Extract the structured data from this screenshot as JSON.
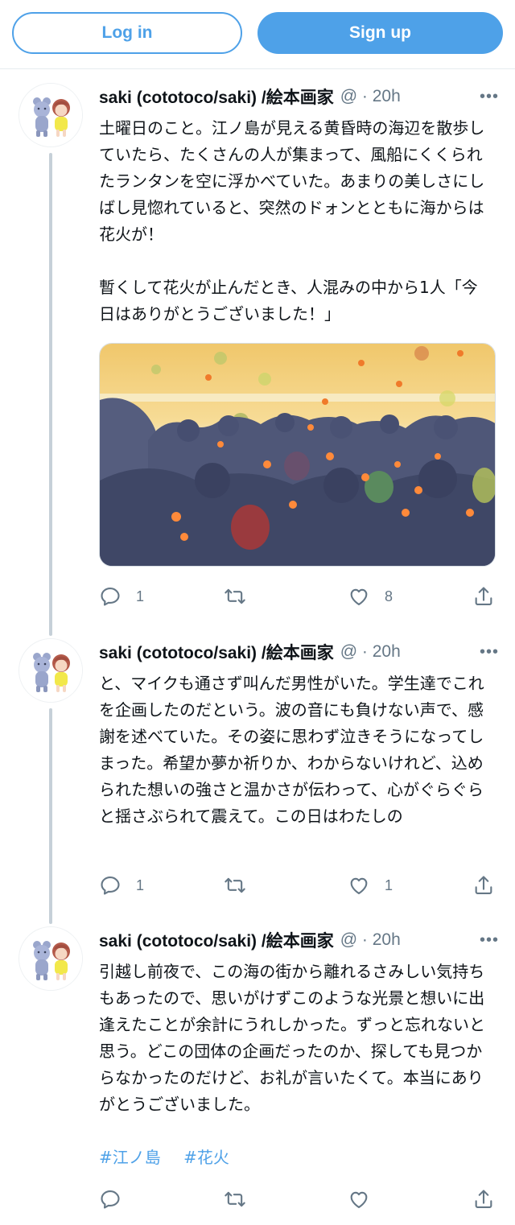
{
  "topbar": {
    "login_label": "Log in",
    "signup_label": "Sign up"
  },
  "colors": {
    "accent": "#4ea1e8",
    "secondary_text": "#657786",
    "thread_line": "#c6d0d8"
  },
  "tweets": [
    {
      "name": "saki (cototoco/saki) /絵本画家",
      "meta": "@ · 20h",
      "text": "土曜日のこと。江ノ島が見える黄昏時の海辺を散歩していたら、たくさんの人が集まって、風船にくくられたランタンを空に浮かべていた。あまりの美しさにしばし見惚れていると、突然のドォンとともに海からは花火が！\n\n暫くして花火が止んだとき、人混みの中から1人「今日はありがとうございました！」",
      "reply_count": "1",
      "retweet_count": "",
      "like_count": "8"
    },
    {
      "name": "saki (cototoco/saki) /絵本画家",
      "meta": "@ · 20h",
      "text": "と、マイクも通さず叫んだ男性がいた。学生達でこれを企画したのだという。波の音にも負けない声で、感謝を述べていた。その姿に思わず泣きそうになってしまった。希望か夢か祈りか、わからないけれど、込められた想いの強さと温かさが伝わって、心がぐらぐらと揺さぶられて震えて。この日はわたしの",
      "reply_count": "1",
      "retweet_count": "",
      "like_count": "1"
    },
    {
      "name": "saki (cototoco/saki) /絵本画家",
      "meta": "@ · 20h",
      "text": "引越し前夜で、この海の街から離れるさみしい気持ちもあったので、思いがけずこのような光景と想いに出逢えたことが余計にうれしかった。ずっと忘れないと思う。どこの団体の企画だったのか、探しても見つからなかったのだけど、お礼が言いたくて。本当にありがとうございました。",
      "hashtags": [
        "#江ノ島",
        "#花火"
      ],
      "reply_count": "",
      "retweet_count": "",
      "like_count": ""
    }
  ],
  "icons": {
    "more": "more-icon",
    "reply": "reply-icon",
    "retweet": "retweet-icon",
    "like": "heart-icon",
    "share": "share-icon"
  }
}
